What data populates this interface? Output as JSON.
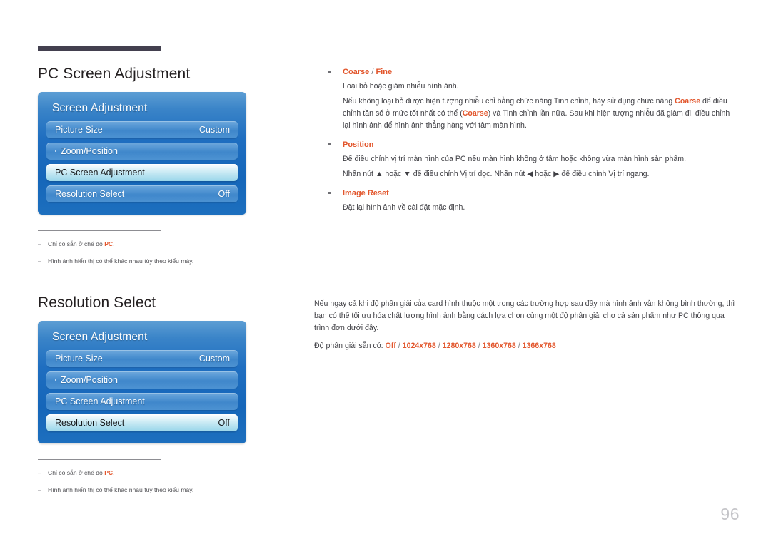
{
  "page": {
    "number": "96"
  },
  "sections": [
    {
      "title": "PC Screen Adjustment",
      "osd": {
        "title": "Screen Adjustment",
        "rows": [
          {
            "label": "Picture Size",
            "value": "Custom",
            "selected": false,
            "dot": false
          },
          {
            "label": "Zoom/Position",
            "value": "",
            "selected": false,
            "dot": true
          },
          {
            "label": "PC Screen Adjustment",
            "value": "",
            "selected": true,
            "dot": false
          },
          {
            "label": "Resolution Select",
            "value": "Off",
            "selected": false,
            "dot": false
          }
        ]
      },
      "footnotes": [
        {
          "dash": "–",
          "text_before": "Chỉ có sẵn ở chế độ ",
          "highlight": "PC",
          "text_after": "."
        },
        {
          "dash": "–",
          "text_before": "Hình ảnh hiển thị có thể khác nhau tùy theo kiểu máy.",
          "highlight": "",
          "text_after": ""
        }
      ]
    },
    {
      "title": "Resolution Select",
      "osd": {
        "title": "Screen Adjustment",
        "rows": [
          {
            "label": "Picture Size",
            "value": "Custom",
            "selected": false,
            "dot": false
          },
          {
            "label": "Zoom/Position",
            "value": "",
            "selected": false,
            "dot": true
          },
          {
            "label": "PC Screen Adjustment",
            "value": "",
            "selected": false,
            "dot": false
          },
          {
            "label": "Resolution Select",
            "value": "Off",
            "selected": true,
            "dot": false
          }
        ]
      },
      "footnotes": [
        {
          "dash": "–",
          "text_before": "Chỉ có sẵn ở chế độ ",
          "highlight": "PC",
          "text_after": "."
        },
        {
          "dash": "–",
          "text_before": "Hình ảnh hiển thị có thể khác nhau tùy theo kiểu máy.",
          "highlight": "",
          "text_after": ""
        }
      ]
    }
  ],
  "right_column": {
    "bullets": [
      {
        "head_part1": "Coarse",
        "head_sep": " / ",
        "head_part2": "Fine",
        "lines": [
          "Loại bỏ hoặc giảm nhiễu hình ảnh."
        ],
        "rich_line_1": "Nếu không loại bỏ được hiện tượng nhiễu chỉ bằng chức năng Tinh chỉnh, hãy sử dụng chức năng ",
        "rich_hl_1": "Coarse",
        "rich_line_2": " để điều chỉnh tần số ở mức tốt nhất có thể (",
        "rich_hl_2": "Coarse",
        "rich_line_3": ") và Tinh chỉnh lần nữa. Sau khi hiện tượng nhiễu đã giảm đi, điều chỉnh lại hình ảnh để hình ảnh thẳng hàng với tâm màn hình."
      },
      {
        "head_part1": "Position",
        "head_sep": "",
        "head_part2": "",
        "lines": [
          "Để điều chỉnh vị trí màn hình của PC nếu màn hình không ở tâm hoặc không vừa màn hình sản phẩm.",
          "Nhấn nút ▲ hoặc ▼ để điều chỉnh Vị trí dọc. Nhấn nút ◀ hoặc ▶ để điều chỉnh Vị trí ngang."
        ]
      },
      {
        "head_part1": "Image Reset",
        "head_sep": "",
        "head_part2": "",
        "lines": [
          "Đặt lại hình ảnh về cài đặt mặc định."
        ]
      }
    ]
  },
  "lower_right": {
    "paragraph": "Nếu ngay cả khi độ phân giải của card hình thuộc một trong các trường hợp sau đây mà hình ảnh vẫn không bình thường, thì bạn có thể tối ưu hóa chất lượng hình ảnh bằng cách lựa chọn cùng một độ phân giải cho cả sản phẩm như PC thông qua trình đơn dưới đây.",
    "list_label": "Độ phân giải sẵn có: ",
    "list_values": [
      "Off",
      "1024x768",
      "1280x768",
      "1360x768",
      "1366x768"
    ],
    "separator": " / "
  },
  "colors": {
    "accent_orange": "#e2552b",
    "panel_blue": "#1f6ec0",
    "selected_cyan": "#bfe6f2",
    "rule_dark": "#43404f",
    "page_number_gray": "#c4c4c8"
  }
}
